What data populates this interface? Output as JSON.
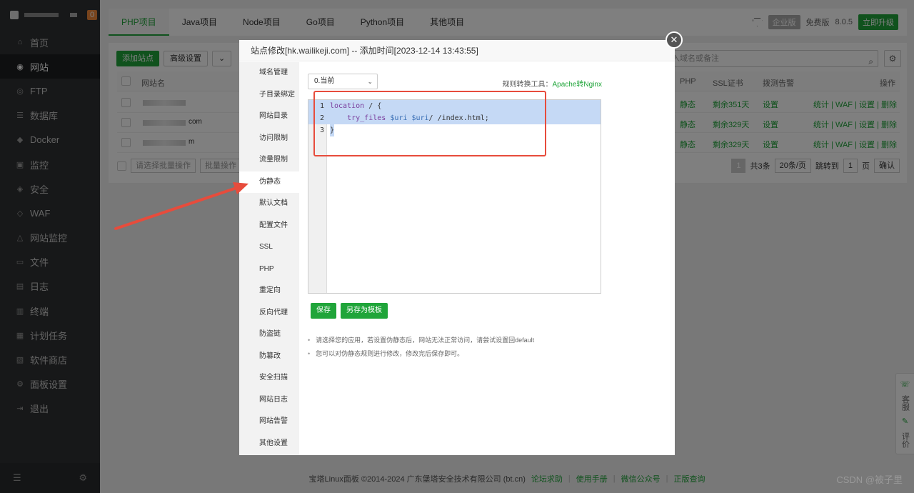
{
  "sidebar": {
    "badge": "0",
    "items": [
      {
        "label": "首页",
        "icon": "home-icon",
        "glyph": "⌂"
      },
      {
        "label": "网站",
        "icon": "globe-icon",
        "glyph": "◉",
        "active": true
      },
      {
        "label": "FTP",
        "icon": "ftp-icon",
        "glyph": "◎"
      },
      {
        "label": "数据库",
        "icon": "database-icon",
        "glyph": "☰"
      },
      {
        "label": "Docker",
        "icon": "docker-icon",
        "glyph": "◆"
      },
      {
        "label": "监控",
        "icon": "monitor-icon",
        "glyph": "▣"
      },
      {
        "label": "安全",
        "icon": "shield-icon",
        "glyph": "◈"
      },
      {
        "label": "WAF",
        "icon": "waf-icon",
        "glyph": "◇"
      },
      {
        "label": "网站监控",
        "icon": "site-monitor-icon",
        "glyph": "△"
      },
      {
        "label": "文件",
        "icon": "folder-icon",
        "glyph": "▭"
      },
      {
        "label": "日志",
        "icon": "log-icon",
        "glyph": "▤"
      },
      {
        "label": "终端",
        "icon": "terminal-icon",
        "glyph": "▥"
      },
      {
        "label": "计划任务",
        "icon": "task-icon",
        "glyph": "▦"
      },
      {
        "label": "软件商店",
        "icon": "store-icon",
        "glyph": "▧"
      },
      {
        "label": "面板设置",
        "icon": "settings-icon",
        "glyph": "⚙"
      },
      {
        "label": "退出",
        "icon": "logout-icon",
        "glyph": "⇥"
      }
    ]
  },
  "topbar": {
    "tabs": [
      "PHP项目",
      "Java项目",
      "Node项目",
      "Go项目",
      "Python项目",
      "其他项目"
    ],
    "edition_badge": "企业版",
    "free_label": "免费版",
    "version": "8.0.5",
    "upgrade": "立即升级"
  },
  "toolbar": {
    "add_site": "添加站点",
    "advanced": "高级设置",
    "search_placeholder": "入域名或备注"
  },
  "table": {
    "headers": {
      "name": "网站名",
      "php": "PHP",
      "ssl": "SSL证书",
      "alert": "拨测告警",
      "ops": "操作"
    },
    "rows": [
      {
        "tail": "",
        "php": "静态",
        "ssl": "剩余351天",
        "alert": "设置",
        "ops": "统计 | WAF | 设置 | 删除"
      },
      {
        "tail": "com",
        "php": "静态",
        "ssl": "剩余329天",
        "alert": "设置",
        "ops": "统计 | WAF | 设置 | 删除"
      },
      {
        "tail": "m",
        "php": "静态",
        "ssl": "剩余329天",
        "alert": "设置",
        "ops": "统计 | WAF | 设置 | 删除"
      }
    ],
    "batch_placeholder": "请选择批量操作",
    "batch_label": "批量操作",
    "pager": {
      "current": "1",
      "total": "共3条",
      "per_page": "20条/页",
      "goto_label": "跳转到",
      "goto_value": "1",
      "page_unit": "页",
      "confirm": "确认"
    }
  },
  "modal": {
    "title": "站点修改[hk.wailikeji.com] -- 添加时间[2023-12-14 13:43:55]",
    "nav": [
      "域名管理",
      "子目录绑定",
      "网站目录",
      "访问限制",
      "流量限制",
      "伪静态",
      "默认文档",
      "配置文件",
      "SSL",
      "PHP",
      "重定向",
      "反向代理",
      "防盗链",
      "防篡改",
      "安全扫描",
      "网站日志",
      "网站告警",
      "其他设置"
    ],
    "nav_active": "伪静态",
    "version_select": "0.当前",
    "rule_tool_label": "规则转换工具：",
    "rule_tool_link": "Apache转Nginx",
    "code": {
      "line1_kw": "location",
      "line1_rest": " / {",
      "line2_kw": "try_files",
      "line2_v1": "$uri",
      "line2_v2": "$uri",
      "line2_rest": "/ /index.html;",
      "line3": "}"
    },
    "save": "保存",
    "save_template": "另存为模板",
    "tips": [
      "请选择您的应用，若设置伪静态后，网站无法正常访问，请尝试设置回default",
      "您可以对伪静态规则进行修改，修改完后保存即可。"
    ]
  },
  "footer": {
    "copyright": "宝塔Linux面板 ©2014-2024 广东堡塔安全技术有限公司 (bt.cn)",
    "links": [
      "论坛求助",
      "使用手册",
      "微信公众号",
      "正版查询"
    ]
  },
  "float_tab": {
    "service": "客服",
    "review": "评价"
  },
  "watermark": "CSDN @被子里",
  "colors": {
    "accent": "#20a53a",
    "highlight_box": "#e74c3c",
    "arrow": "#e74c3c"
  }
}
